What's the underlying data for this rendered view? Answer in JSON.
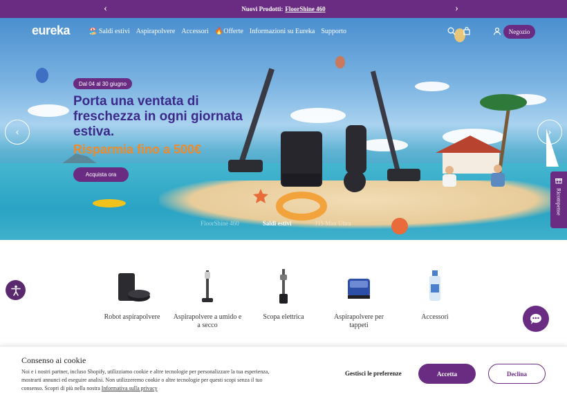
{
  "announcement": {
    "prefix": "Nuovi Prodotti:",
    "link": "FloorShine 460",
    "prev_icon": "chevron-left-icon",
    "next_icon": "chevron-right-icon"
  },
  "nav": {
    "logo": "eureka",
    "items": [
      "🏖️ Saldi estivi",
      "Aspirapolvere",
      "Accessori",
      "🔥Offerte",
      "Informazioni su Eureka",
      "Supporto"
    ],
    "shop_label": "Negozio",
    "icons": [
      "search-icon",
      "bag-icon",
      "account-icon"
    ]
  },
  "hero": {
    "badge": "Dal 04 al 30 giugno",
    "headline": "Porta una ventata di freschezza in ogni giornata estiva.",
    "subline": "Risparmia fino a 500€",
    "cta": "Acquista ora",
    "slides": [
      "FloorShine 460",
      "Saldi estivi",
      "J15 Max Ultra"
    ],
    "active_slide": 1
  },
  "rewards": {
    "label": "Ricompense",
    "icon": "gift-icon"
  },
  "categories": [
    {
      "label": "Robot aspirapolvere"
    },
    {
      "label": "Aspirapolvere a umido e a secco"
    },
    {
      "label": "Scopa elettrica"
    },
    {
      "label": "Aspirapolvere per tappeti"
    },
    {
      "label": "Accessori"
    }
  ],
  "cookie": {
    "title": "Consenso ai cookie",
    "text": "Noi e i nostri partner, incluso Shopify, utilizziamo cookie e altre tecnologie per personalizzare la tua esperienza, mostrarti annunci ed eseguire analisi. Non utilizzeremo cookie o altre tecnologie per questi scopi senza il tuo consenso. Scopri di più nella nostra",
    "policy_link": "Informativa sulla privacy",
    "prefs": "Gestisci le preferenze",
    "accept": "Accetta",
    "decline": "Declina"
  },
  "colors": {
    "brand": "#6a2c82",
    "headline": "#3b2a8a",
    "accent_orange": "#f08a2a"
  }
}
